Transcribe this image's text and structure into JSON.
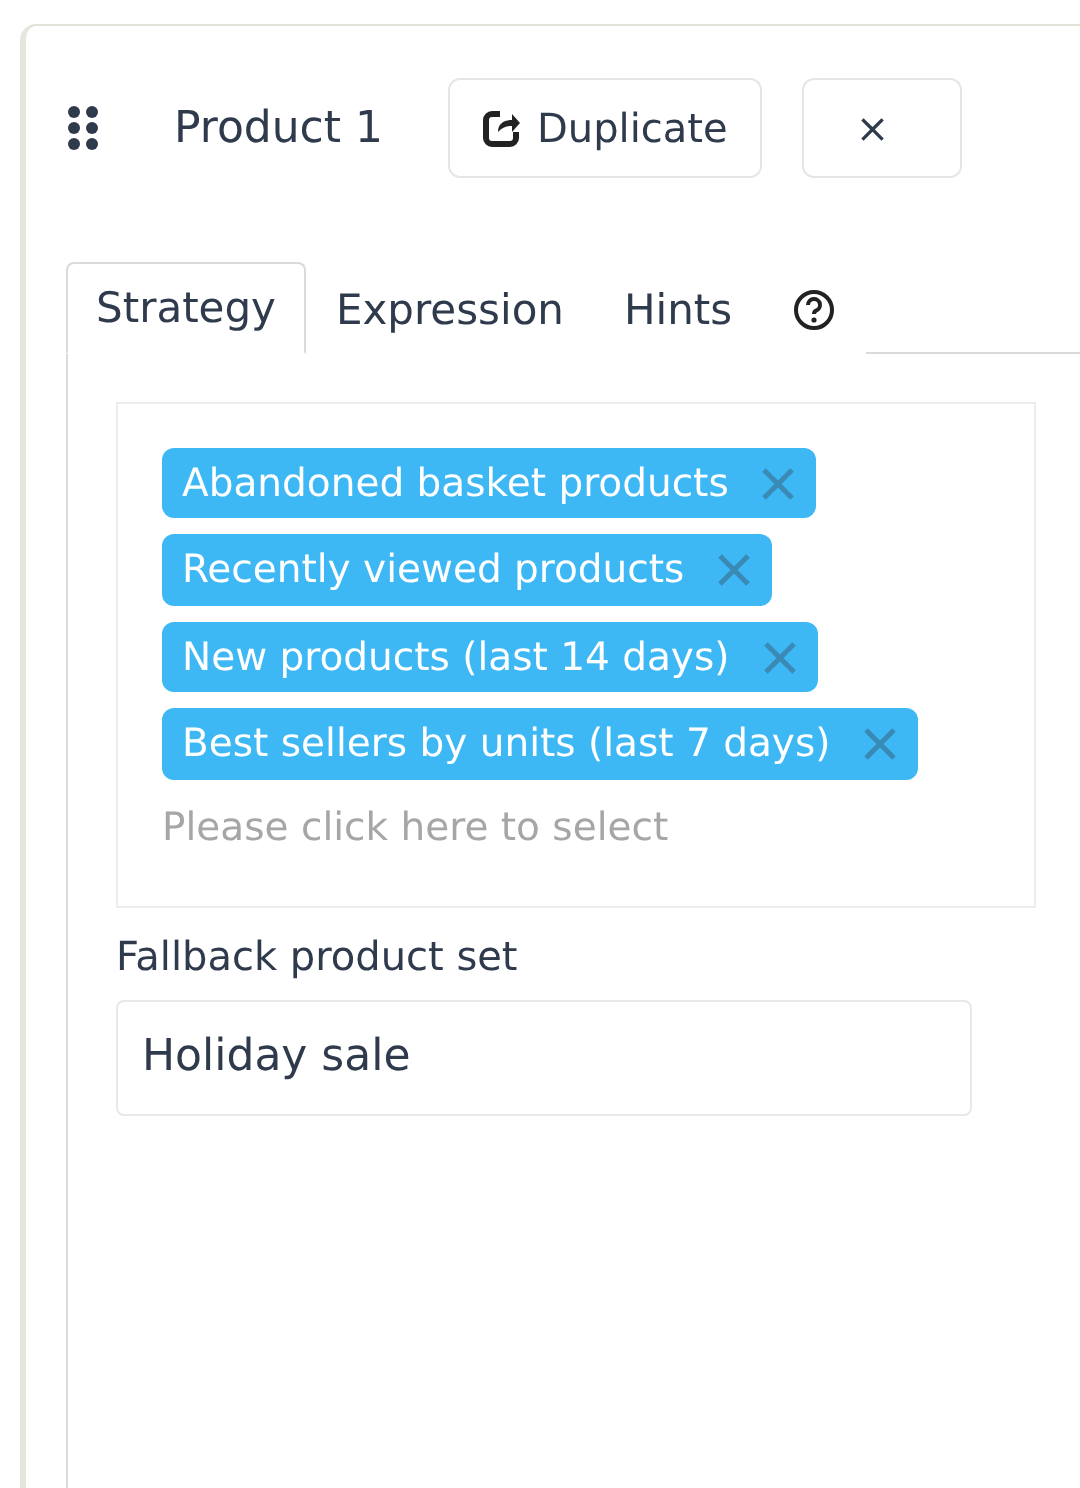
{
  "header": {
    "title": "Product 1",
    "buttons": [
      {
        "kind": "duplicate",
        "label": "Duplicate"
      },
      {
        "kind": "close",
        "label": "×"
      }
    ]
  },
  "tabs": [
    {
      "kind": "text",
      "label": "Strategy",
      "selected": true
    },
    {
      "kind": "text",
      "label": "Expression",
      "selected": false
    },
    {
      "kind": "text",
      "label": "Hints",
      "selected": false
    },
    {
      "kind": "help",
      "selected": false
    }
  ],
  "strategies": {
    "tags": [
      "Abandoned basket products",
      "Recently viewed products",
      "New products (last 14 days)",
      "Best sellers by units (last 7 days)"
    ],
    "placeholder": "Please click here to select"
  },
  "fallback": {
    "label": "Fallback product set",
    "value": "Holiday sale"
  }
}
